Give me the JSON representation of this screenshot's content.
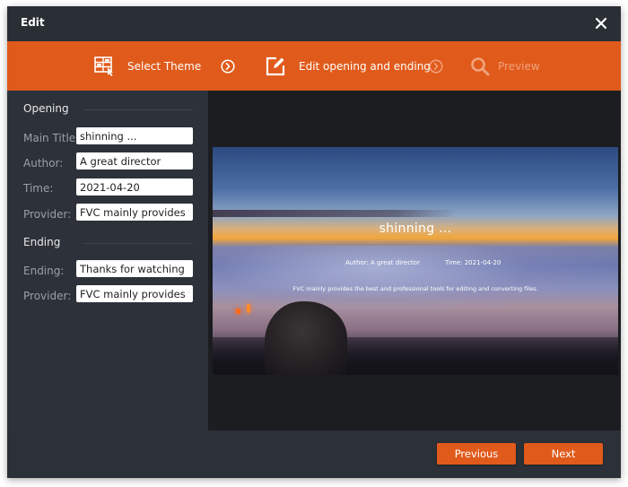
{
  "window": {
    "title": "Edit",
    "close_icon": "close-icon"
  },
  "steps": [
    {
      "label": "Select Theme",
      "icon": "theme-grid-icon",
      "state": "done"
    },
    {
      "label": "Edit opening and ending",
      "icon": "edit-icon",
      "state": "active"
    },
    {
      "label": "Preview",
      "icon": "search-icon",
      "state": "disabled"
    }
  ],
  "opening": {
    "heading": "Opening",
    "fields": [
      {
        "label": "Main Title:",
        "value": "shinning ..."
      },
      {
        "label": "Author:",
        "value": "A great director"
      },
      {
        "label": "Time:",
        "value": "2021-04-20"
      },
      {
        "label": "Provider:",
        "value": "FVC mainly provides the best and professional tools for editing and converting files."
      }
    ]
  },
  "ending": {
    "heading": "Ending",
    "fields": [
      {
        "label": "Ending:",
        "value": "Thanks for watching"
      },
      {
        "label": "Provider:",
        "value": "FVC mainly provides the best and professional tools for editing and converting files."
      }
    ]
  },
  "preview": {
    "title": "shinning ...",
    "author": "Author:  A great director",
    "time": "Time:  2021-04-20",
    "provider": "FVC mainly provides the best and professional tools for editing and converting files."
  },
  "footer": {
    "previous_label": "Previous",
    "next_label": "Next"
  },
  "colors": {
    "accent": "#e05a1b",
    "titlebar": "#2a2e35",
    "panel": "#2d3139",
    "preview_bg": "#1b1d21"
  }
}
